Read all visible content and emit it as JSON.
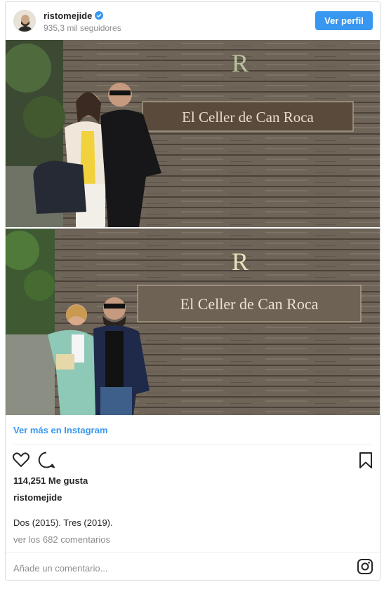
{
  "header": {
    "username": "ristomejide",
    "followers": "935,3 mil seguidores",
    "follow_label": "Ver perfil"
  },
  "photo": {
    "sign_text": "El Celler de Can Roca",
    "logo_letter": "R"
  },
  "post": {
    "more_link": "Ver más en Instagram",
    "likes": "114,251 Me gusta",
    "author": "ristomejide",
    "caption": "Dos (2015). Tres (2019).",
    "comments_link": "ver los 682 comentarios",
    "comment_placeholder": "Añade un comentario..."
  },
  "colors": {
    "accent": "#3897f0",
    "muted": "#8e8e8e",
    "text": "#262626",
    "border": "#dbdbdb"
  },
  "icons": [
    "verified-badge-icon",
    "heart-icon",
    "comment-icon",
    "bookmark-icon",
    "instagram-icon"
  ]
}
